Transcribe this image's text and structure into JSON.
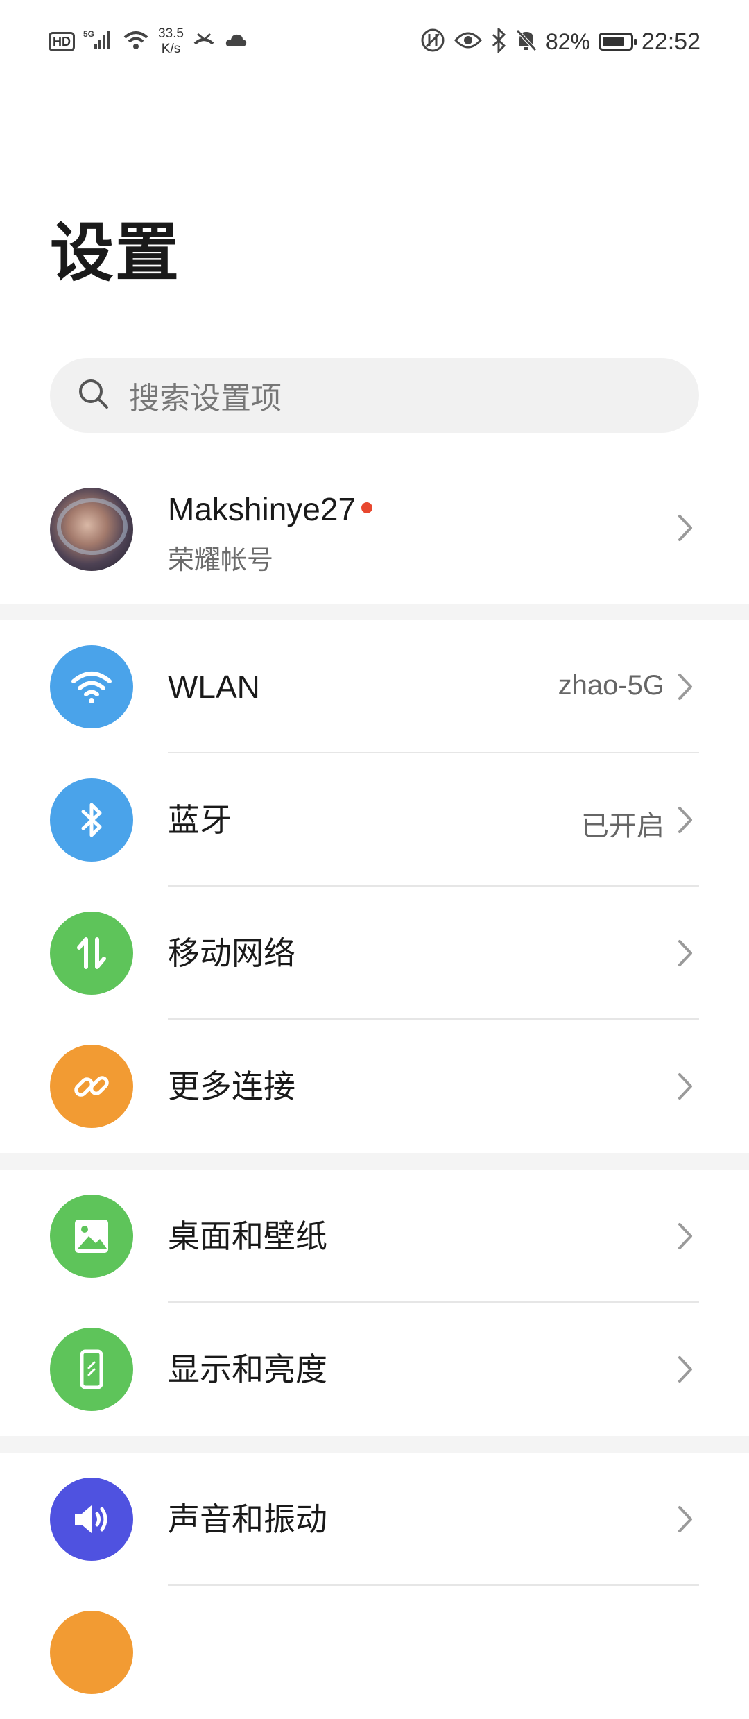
{
  "status_bar": {
    "hd": "HD",
    "network": "5G",
    "speed_value": "33.5",
    "speed_unit": "K/s",
    "battery_percent": "82%",
    "battery_level": 0.82,
    "time": "22:52"
  },
  "page_title": "设置",
  "search": {
    "placeholder": "搜索设置项"
  },
  "account": {
    "name": "Makshinye27",
    "subtitle": "荣耀帐号",
    "notification_dot_color": "#e8482f"
  },
  "settings": {
    "group1": [
      {
        "label": "WLAN",
        "value": "zhao-5G",
        "icon": "wifi-icon",
        "color": "#4aa3ea"
      },
      {
        "label": "蓝牙",
        "value": "已开启",
        "icon": "bluetooth-icon",
        "color": "#4aa3ea"
      },
      {
        "label": "移动网络",
        "value": "",
        "icon": "mobile-data-icon",
        "color": "#5ec45a"
      },
      {
        "label": "更多连接",
        "value": "",
        "icon": "link-icon",
        "color": "#f29b33"
      }
    ],
    "group2": [
      {
        "label": "桌面和壁纸",
        "icon": "wallpaper-icon",
        "color": "#5ec45a"
      },
      {
        "label": "显示和亮度",
        "icon": "display-icon",
        "color": "#5ec45a"
      }
    ],
    "group3": [
      {
        "label": "声音和振动",
        "icon": "sound-icon",
        "color": "#4f52e0"
      }
    ]
  }
}
